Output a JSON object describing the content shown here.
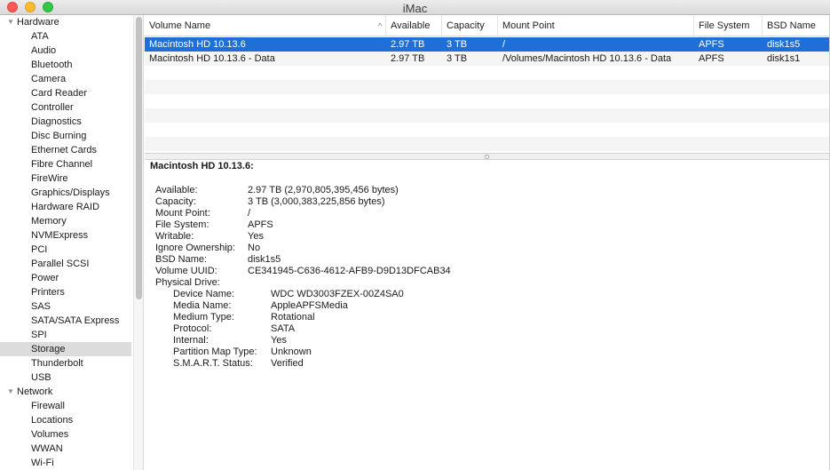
{
  "window": {
    "title": "iMac"
  },
  "sidebar": {
    "groups": [
      {
        "label": "Hardware",
        "items": [
          "ATA",
          "Audio",
          "Bluetooth",
          "Camera",
          "Card Reader",
          "Controller",
          "Diagnostics",
          "Disc Burning",
          "Ethernet Cards",
          "Fibre Channel",
          "FireWire",
          "Graphics/Displays",
          "Hardware RAID",
          "Memory",
          "NVMExpress",
          "PCI",
          "Parallel SCSI",
          "Power",
          "Printers",
          "SAS",
          "SATA/SATA Express",
          "SPI",
          "Storage",
          "Thunderbolt",
          "USB"
        ]
      },
      {
        "label": "Network",
        "items": [
          "Firewall",
          "Locations",
          "Volumes",
          "WWAN",
          "Wi-Fi"
        ]
      }
    ],
    "selected": "Storage"
  },
  "table": {
    "columns": [
      "Volume Name",
      "Available",
      "Capacity",
      "Mount Point",
      "File System",
      "BSD Name"
    ],
    "rows": [
      [
        "Macintosh HD 10.13.6",
        "2.97 TB",
        "3 TB",
        "/",
        "APFS",
        "disk1s5"
      ],
      [
        "Macintosh HD 10.13.6 - Data",
        "2.97 TB",
        "3 TB",
        "/Volumes/Macintosh HD 10.13.6 - Data",
        "APFS",
        "disk1s1"
      ]
    ],
    "selected_row": 0
  },
  "detail": {
    "title": "Macintosh HD 10.13.6:",
    "fields": [
      {
        "key": "Available:",
        "value": "2.97 TB (2,970,805,395,456 bytes)"
      },
      {
        "key": "Capacity:",
        "value": "3 TB (3,000,383,225,856 bytes)"
      },
      {
        "key": "Mount Point:",
        "value": "/"
      },
      {
        "key": "File System:",
        "value": "APFS"
      },
      {
        "key": "Writable:",
        "value": "Yes"
      },
      {
        "key": "Ignore Ownership:",
        "value": "No"
      },
      {
        "key": "BSD Name:",
        "value": "disk1s5"
      },
      {
        "key": "Volume UUID:",
        "value": "CE341945-C636-4612-AFB9-D9D13DFCAB34"
      },
      {
        "key": "Physical Drive:",
        "value": ""
      }
    ],
    "drive_fields": [
      {
        "key": "Device Name:",
        "value": "WDC WD3003FZEX-00Z4SA0"
      },
      {
        "key": "Media Name:",
        "value": "AppleAPFSMedia"
      },
      {
        "key": "Medium Type:",
        "value": "Rotational"
      },
      {
        "key": "Protocol:",
        "value": "SATA"
      },
      {
        "key": "Internal:",
        "value": "Yes"
      },
      {
        "key": "Partition Map Type:",
        "value": "Unknown"
      },
      {
        "key": "S.M.A.R.T. Status:",
        "value": "Verified"
      }
    ]
  }
}
